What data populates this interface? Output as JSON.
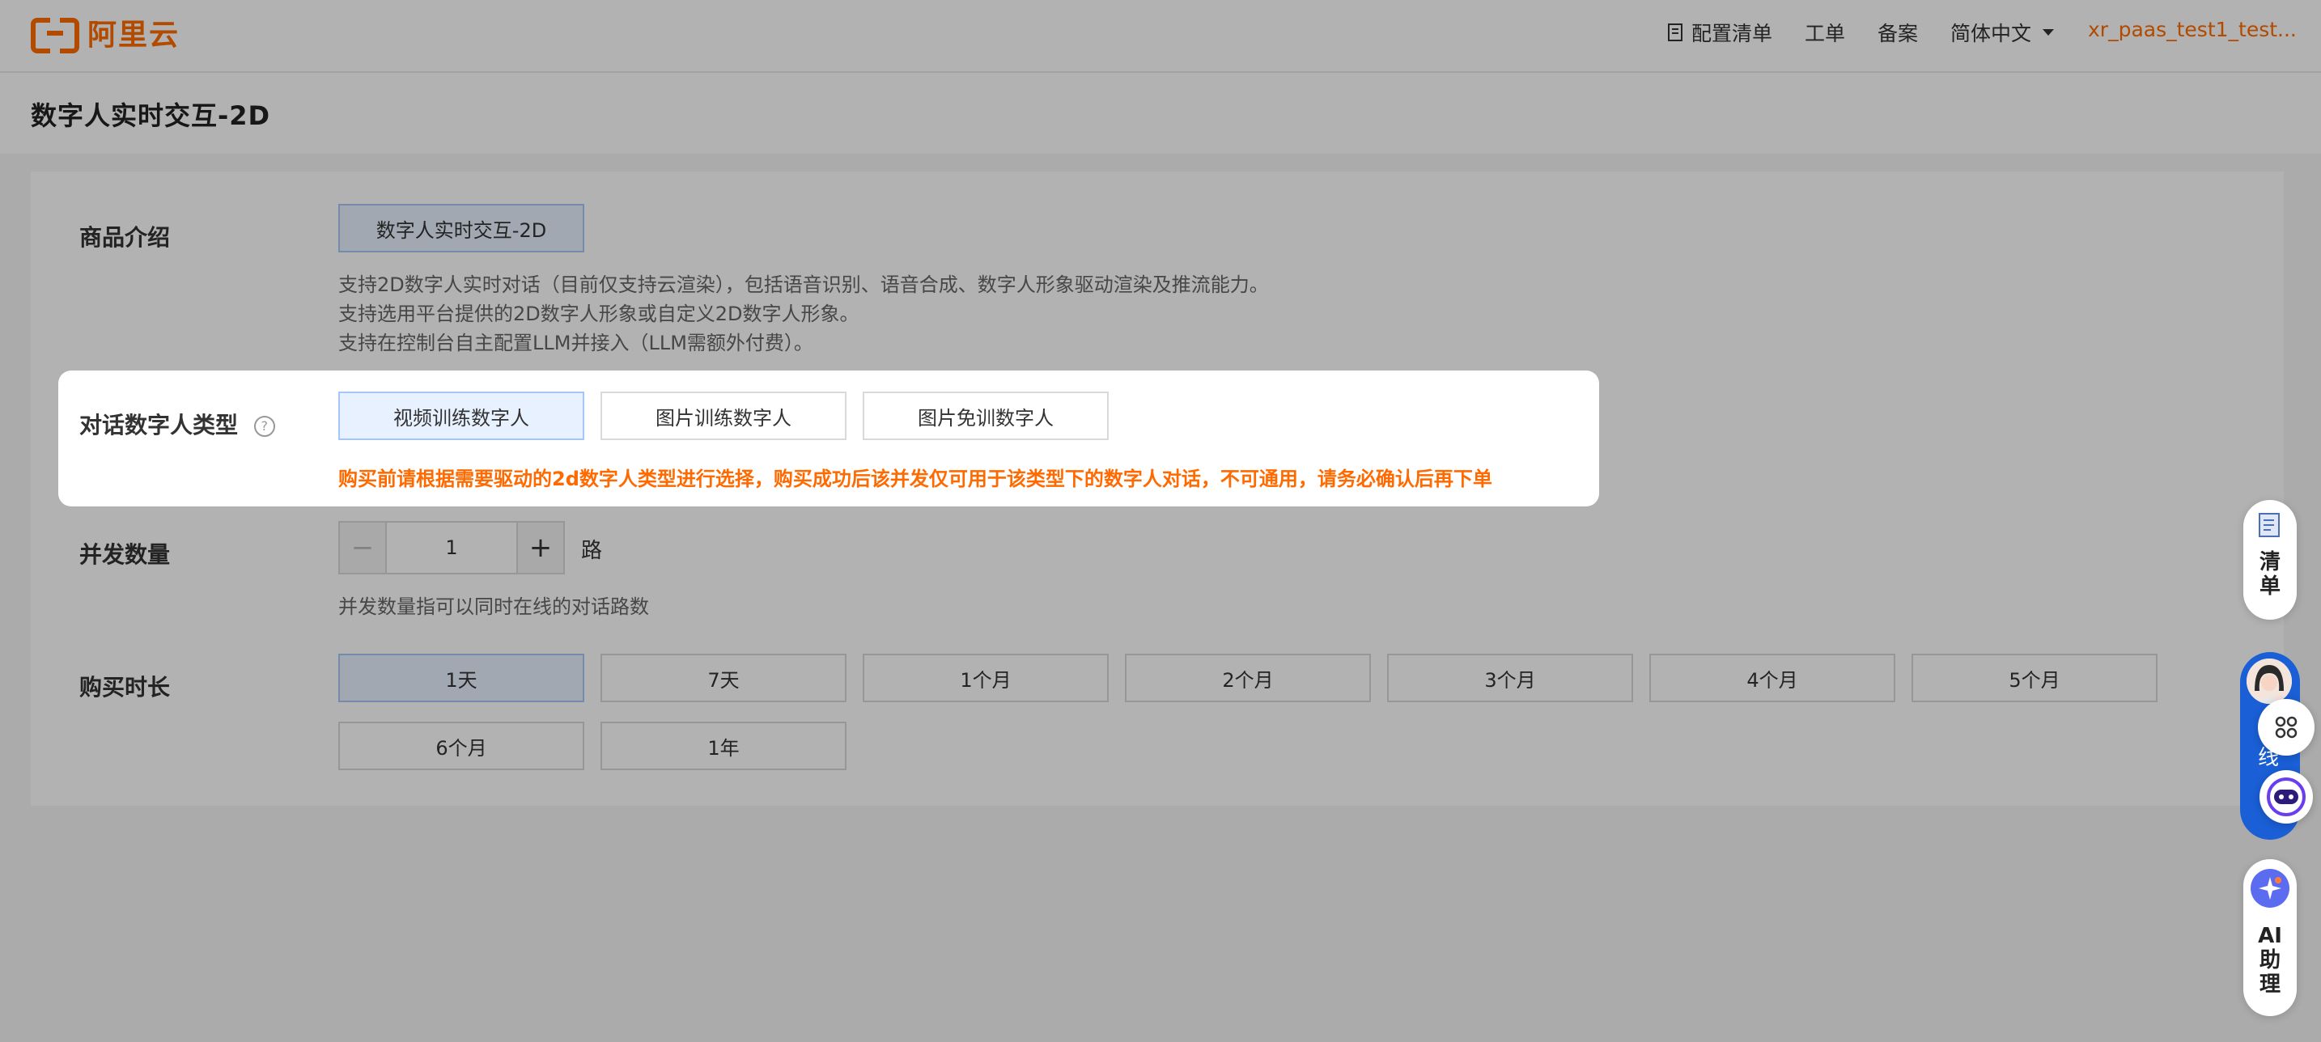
{
  "header": {
    "logo_text": "阿里云",
    "nav": [
      {
        "label": "配置清单",
        "icon": "list-icon"
      },
      {
        "label": "工单"
      },
      {
        "label": "备案"
      },
      {
        "label": "简体中文",
        "dropdown": true
      }
    ],
    "user": "xr_paas_test1_test..."
  },
  "page_title": "数字人实时交互-2D",
  "product": {
    "label": "商品介绍",
    "option": "数字人实时交互-2D",
    "description": [
      "支持2D数字人实时对话（目前仅支持云渲染），包括语音识别、语音合成、数字人形象驱动渲染及推流能力。",
      "支持选用平台提供的2D数字人形象或自定义2D数字人形象。",
      "支持在控制台自主配置LLM并接入（LLM需额外付费）。"
    ]
  },
  "avatar_type": {
    "label": "对话数字人类型",
    "help": "?",
    "options": [
      "视频训练数字人",
      "图片训练数字人",
      "图片免训数字人"
    ],
    "selected_index": 0,
    "warning": "购买前请根据需要驱动的2d数字人类型进行选择，购买成功后该并发仅可用于该类型下的数字人对话，不可通用，请务必确认后再下单"
  },
  "concurrency": {
    "label": "并发数量",
    "minus": "−",
    "plus": "+",
    "value": "1",
    "unit": "路",
    "hint": "并发数量指可以同时在线的对话路数"
  },
  "duration": {
    "label": "购买时长",
    "options": [
      "1天",
      "7天",
      "1个月",
      "2个月",
      "3个月",
      "4个月",
      "5个月",
      "6个月",
      "1年"
    ],
    "selected_index": 0
  },
  "sidebar": {
    "list_label_1": "清",
    "list_label_2": "单",
    "online_label": "线",
    "ai_1": "AI",
    "ai_2": "助",
    "ai_3": "理"
  },
  "colors": {
    "brand": "#ff6a00",
    "selected_bg": "#e8f1ff",
    "accent_blue": "#1a5fd6"
  }
}
